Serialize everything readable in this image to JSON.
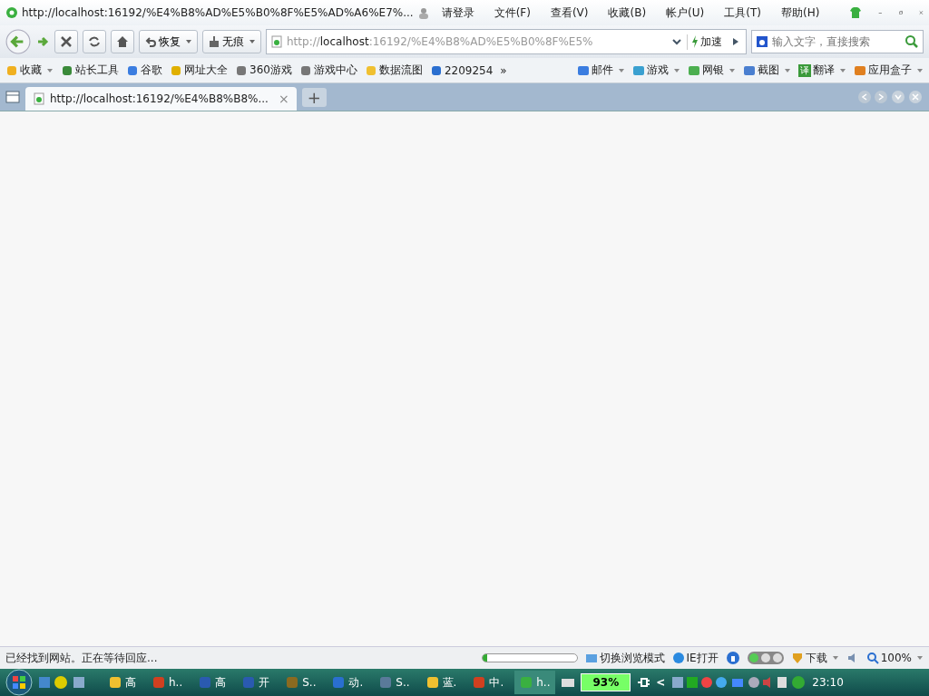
{
  "window": {
    "title": "http://localhost:16192/%E4%B8%AD%E5%B0%8F%E5%AD%A6%E7%...",
    "login": "请登录",
    "menu": [
      "文件(F)",
      "查看(V)",
      "收藏(B)",
      "帐户(U)",
      "工具(T)",
      "帮助(H)"
    ]
  },
  "toolbar": {
    "restore": "恢复",
    "incognito": "无痕",
    "url_scheme": "http://",
    "url_host": "localhost",
    "url_rest": ":16192/%E4%B8%AD%E5%B0%8F%E5%",
    "speedup": "加速",
    "search_placeholder": "输入文字，直接搜索"
  },
  "bookmarks": [
    "收藏",
    "站长工具",
    "谷歌",
    "网址大全",
    "360游戏",
    "游戏中心",
    "数据流图",
    "2209254"
  ],
  "more": "»",
  "tools": [
    "邮件",
    "游戏",
    "网银",
    "截图",
    "翻译",
    "应用盒子"
  ],
  "translate_glyph": "译",
  "tabs": [
    {
      "title": "http://localhost:16192/%E4%B8%B8%...",
      "selected": true
    }
  ],
  "tab_close": "×",
  "tab_new": "+",
  "status_bar": {
    "message": "已经找到网站。正在等待回应...",
    "progress": {
      "level": 0.05
    },
    "switch_mode": "切换浏览模式",
    "ie_open": "IE打开",
    "download": "下载",
    "zoom": "100%"
  },
  "taskbar": {
    "items": [
      {
        "label": "高",
        "selected": false
      },
      {
        "label": "h..",
        "selected": false
      },
      {
        "label": "高",
        "selected": false
      },
      {
        "label": "开",
        "selected": false
      },
      {
        "label": "S..",
        "selected": false
      },
      {
        "label": "动.",
        "selected": false
      },
      {
        "label": "S..",
        "selected": false
      },
      {
        "label": "蓝.",
        "selected": false
      },
      {
        "label": "中.",
        "selected": false
      },
      {
        "label": "h..",
        "selected": true
      }
    ],
    "battery": "93%",
    "clock": "23:10",
    "tray_arrow": "<"
  }
}
